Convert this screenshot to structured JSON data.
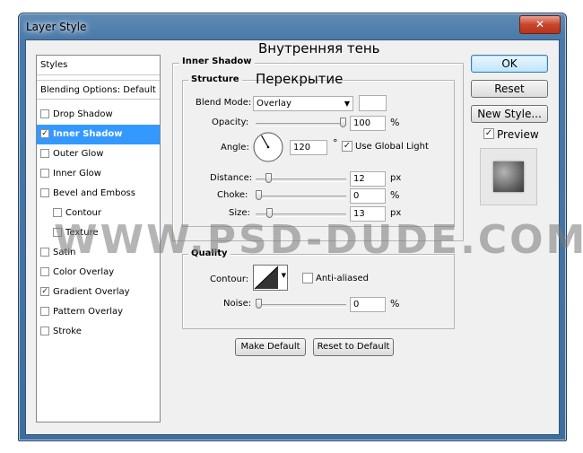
{
  "window": {
    "title": "Layer Style",
    "close_glyph": "✕"
  },
  "styles_panel": {
    "header": "Styles",
    "blending": "Blending Options: Default",
    "items": [
      {
        "label": "Drop Shadow",
        "checked": false,
        "selected": false,
        "indent": false
      },
      {
        "label": "Inner Shadow",
        "checked": true,
        "selected": true,
        "indent": false
      },
      {
        "label": "Outer Glow",
        "checked": false,
        "selected": false,
        "indent": false
      },
      {
        "label": "Inner Glow",
        "checked": false,
        "selected": false,
        "indent": false
      },
      {
        "label": "Bevel and Emboss",
        "checked": false,
        "selected": false,
        "indent": false
      },
      {
        "label": "Contour",
        "checked": false,
        "selected": false,
        "indent": true
      },
      {
        "label": "Texture",
        "checked": false,
        "selected": false,
        "indent": true
      },
      {
        "label": "Satin",
        "checked": false,
        "selected": false,
        "indent": false
      },
      {
        "label": "Color Overlay",
        "checked": false,
        "selected": false,
        "indent": false
      },
      {
        "label": "Gradient Overlay",
        "checked": true,
        "selected": false,
        "indent": false
      },
      {
        "label": "Pattern Overlay",
        "checked": false,
        "selected": false,
        "indent": false
      },
      {
        "label": "Stroke",
        "checked": false,
        "selected": false,
        "indent": false
      }
    ]
  },
  "inner_shadow": {
    "title": "Inner Shadow",
    "structure": {
      "legend": "Structure",
      "blend_mode_label": "Blend Mode:",
      "blend_mode_value": "Overlay",
      "blend_color": "#ffffff",
      "opacity_label": "Opacity:",
      "opacity_value": "100",
      "opacity_unit": "%",
      "opacity_level": 100,
      "angle_label": "Angle:",
      "angle_value": "120",
      "angle_unit": "°",
      "use_global_light_label": "Use Global Light",
      "use_global_light_checked": true,
      "distance_label": "Distance:",
      "distance_value": "12",
      "distance_unit": "px",
      "distance_level": 12,
      "choke_label": "Choke:",
      "choke_value": "0",
      "choke_unit": "%",
      "choke_level": 0,
      "size_label": "Size:",
      "size_value": "13",
      "size_unit": "px",
      "size_level": 13
    },
    "quality": {
      "legend": "Quality",
      "contour_label": "Contour:",
      "anti_aliased_label": "Anti-aliased",
      "anti_aliased_checked": false,
      "noise_label": "Noise:",
      "noise_value": "0",
      "noise_unit": "%",
      "noise_level": 0
    },
    "make_default": "Make Default",
    "reset_to_default": "Reset to Default"
  },
  "actions": {
    "ok": "OK",
    "reset": "Reset",
    "new_style": "New Style...",
    "preview_label": "Preview",
    "preview_checked": true
  },
  "annotations": {
    "inner_shadow_ru": "Внутренняя тень",
    "overlay_ru": "Перекрытие"
  },
  "watermark": "WWW.PSD-DUDE.COM",
  "icons": {
    "checkmark": "✓",
    "dropdown": "▼"
  }
}
